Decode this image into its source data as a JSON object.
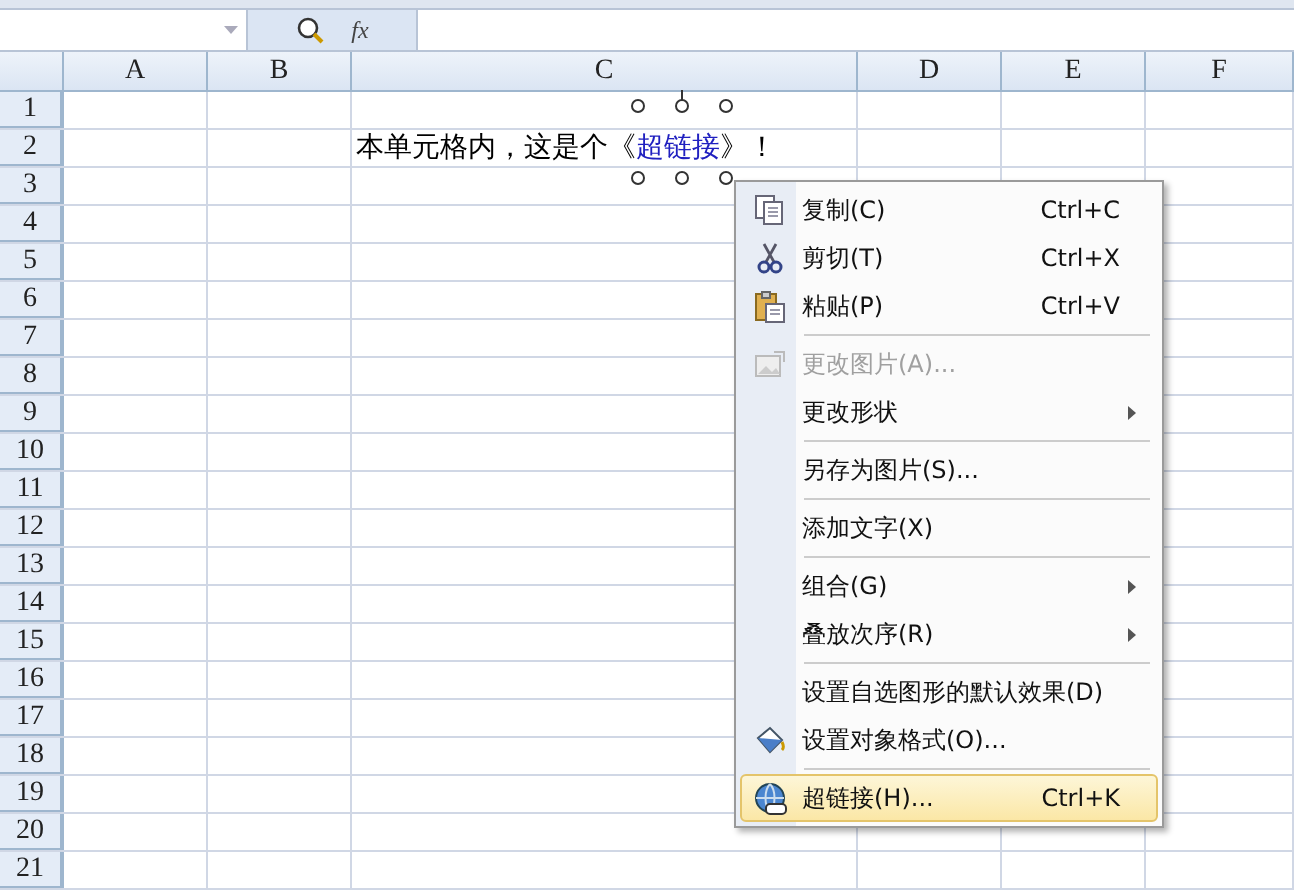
{
  "formula_bar": {
    "fx": "fx"
  },
  "columns": [
    "A",
    "B",
    "C",
    "D",
    "E",
    "F"
  ],
  "rows": [
    {
      "header": "1"
    },
    {
      "header": "2",
      "content": {
        "text_before": "本单元格内，这是个《",
        "link": "超链接",
        "text_after": "》！",
        "shape_selected": true
      }
    },
    {
      "header": "3"
    },
    {
      "header": "4"
    },
    {
      "header": "5"
    },
    {
      "header": "6"
    },
    {
      "header": "7"
    },
    {
      "header": "8"
    },
    {
      "header": "9"
    },
    {
      "header": "10"
    },
    {
      "header": "11"
    },
    {
      "header": "12"
    },
    {
      "header": "13"
    },
    {
      "header": "14"
    },
    {
      "header": "15"
    },
    {
      "header": "16"
    },
    {
      "header": "17"
    },
    {
      "header": "18"
    },
    {
      "header": "19"
    },
    {
      "header": "20"
    },
    {
      "header": "21"
    }
  ],
  "context_menu": [
    {
      "kind": "copy",
      "label": "复制(C)",
      "shortcut": "Ctrl+C",
      "submenu": false,
      "disabled": false,
      "selected": false
    },
    {
      "kind": "cut",
      "label": "剪切(T)",
      "shortcut": "Ctrl+X",
      "submenu": false,
      "disabled": false,
      "selected": false
    },
    {
      "kind": "paste",
      "label": "粘贴(P)",
      "shortcut": "Ctrl+V",
      "submenu": false,
      "disabled": false,
      "selected": false
    },
    {
      "kind": "separator"
    },
    {
      "kind": "picture",
      "label": "更改图片(A)...",
      "submenu": false,
      "disabled": true,
      "selected": false
    },
    {
      "kind": "item",
      "label": "更改形状",
      "submenu": true,
      "disabled": false,
      "selected": false
    },
    {
      "kind": "separator"
    },
    {
      "kind": "item",
      "label": "另存为图片(S)...",
      "submenu": false,
      "disabled": false,
      "selected": false
    },
    {
      "kind": "separator"
    },
    {
      "kind": "item",
      "label": "添加文字(X)",
      "submenu": false,
      "disabled": false,
      "selected": false
    },
    {
      "kind": "separator"
    },
    {
      "kind": "item",
      "label": "组合(G)",
      "submenu": true,
      "disabled": false,
      "selected": false
    },
    {
      "kind": "item",
      "label": "叠放次序(R)",
      "submenu": true,
      "disabled": false,
      "selected": false
    },
    {
      "kind": "separator"
    },
    {
      "kind": "item",
      "label": "设置自选图形的默认效果(D)",
      "submenu": false,
      "disabled": false,
      "selected": false
    },
    {
      "kind": "format",
      "label": "设置对象格式(O)...",
      "submenu": false,
      "disabled": false,
      "selected": false
    },
    {
      "kind": "separator"
    },
    {
      "kind": "link",
      "label": "超链接(H)...",
      "shortcut": "Ctrl+K",
      "submenu": false,
      "disabled": false,
      "selected": true
    }
  ]
}
